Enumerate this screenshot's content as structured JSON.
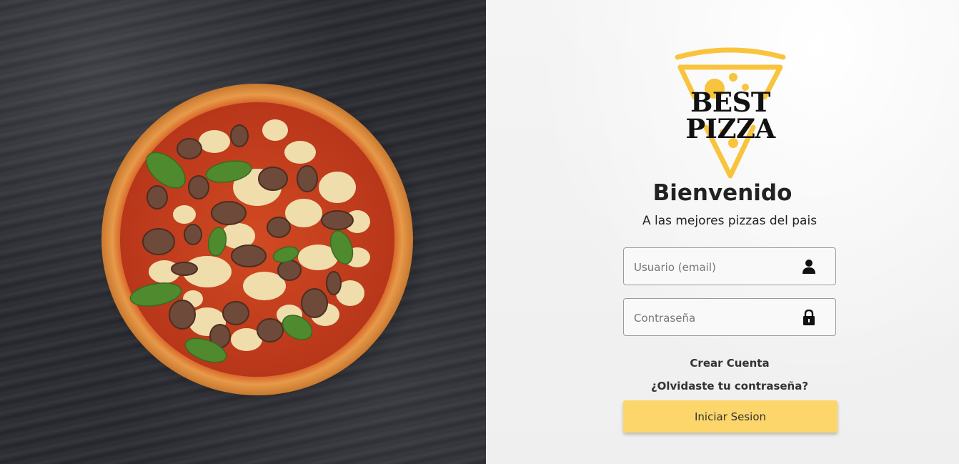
{
  "hero": {
    "image": "pizza-on-dark-slate"
  },
  "brand": {
    "name": "BEST PIZZA",
    "accent_color": "#f9c43d"
  },
  "welcome": {
    "title": "Bienvenido",
    "subtitle": "A las mejores pizzas del pais"
  },
  "form": {
    "email": {
      "placeholder": "Usuario (email)",
      "value": "",
      "icon": "user-icon"
    },
    "password": {
      "placeholder": "Contraseña",
      "value": "",
      "icon": "lock-icon"
    },
    "create_account": "Crear Cuenta",
    "forgot_password": "¿Olvidaste tu contraseña?",
    "submit_label": "Iniciar Sesion",
    "submit_color": "#fcd66b"
  }
}
